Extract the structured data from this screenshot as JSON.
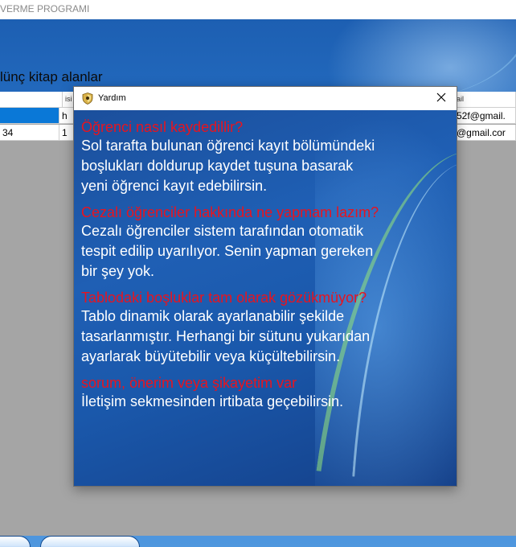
{
  "main_window": {
    "title": "VERME PROGRAMI",
    "section_label": "lünç kitap alanlar"
  },
  "grid": {
    "columns": [
      "isi",
      "nail"
    ],
    "rows": [
      {
        "c1": "",
        "c2": "h",
        "c3": "52f@gmail."
      },
      {
        "c1": "34",
        "c2": "1",
        "c3": "@gmail.cor"
      }
    ]
  },
  "dialog": {
    "title": "Yardım",
    "close_icon": "close-icon",
    "app_icon": "shield-icon",
    "items": [
      {
        "question": "Öğrenci nasıl kaydedillir?",
        "answer_lines": [
          "Sol tarafta bulunan öğrenci kayıt bölümündeki",
          "boşlukları doldurup kaydet tuşuna basarak",
          "yeni öğrenci kayıt edebilirsin."
        ]
      },
      {
        "question": "Cezalı öğrenciler hakkında ne yapmam lazım?",
        "answer_lines": [
          "Cezalı öğrenciler sistem tarafından otomatik",
          "tespit edilip uyarılıyor. Senin yapman gereken",
          "bir şey yok."
        ]
      },
      {
        "question": "Tablodaki boşluklar tam olarak gözükmüyor?",
        "answer_lines": [
          "Tablo dinamik olarak ayarlanabilir şekilde",
          "tasarlanmıştır. Herhangi bir sütunu yukarıdan",
          "ayarlarak büyütebilir veya küçültebilirsin."
        ]
      },
      {
        "question": "sorum, önerim veya şikayetim var",
        "answer_lines": [
          "İletişim sekmesinden irtibata geçebilirsin."
        ]
      }
    ]
  },
  "colors": {
    "question": "#e8141f",
    "answer": "#ffffff",
    "selection": "#0a78d7"
  }
}
